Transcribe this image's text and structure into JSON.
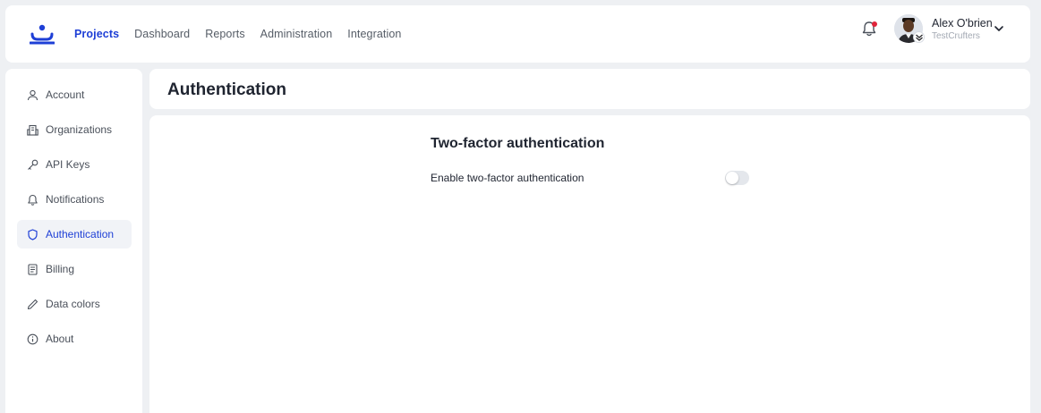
{
  "colors": {
    "accent": "#1e3fd6",
    "notification_dot": "#e0243b",
    "background": "#eef0f3"
  },
  "nav": {
    "logo_icon": "app-logo-icon",
    "items": [
      {
        "label": "Projects",
        "active": true
      },
      {
        "label": "Dashboard",
        "active": false
      },
      {
        "label": "Reports",
        "active": false
      },
      {
        "label": "Administration",
        "active": false
      },
      {
        "label": "Integration",
        "active": false
      }
    ]
  },
  "user": {
    "name": "Alex O'brien",
    "organization": "TestCrufters"
  },
  "sidebar": {
    "items": [
      {
        "label": "Account",
        "icon": "user-icon",
        "active": false
      },
      {
        "label": "Organizations",
        "icon": "building-icon",
        "active": false
      },
      {
        "label": "API Keys",
        "icon": "key-icon",
        "active": false
      },
      {
        "label": "Notifications",
        "icon": "bell-icon",
        "active": false
      },
      {
        "label": "Authentication",
        "icon": "shield-icon",
        "active": true
      },
      {
        "label": "Billing",
        "icon": "receipt-icon",
        "active": false
      },
      {
        "label": "Data colors",
        "icon": "pen-icon",
        "active": false
      },
      {
        "label": "About",
        "icon": "info-icon",
        "active": false
      }
    ]
  },
  "page": {
    "title": "Authentication",
    "section_title": "Two-factor authentication",
    "setting_label": "Enable two-factor authentication",
    "toggle_enabled": false
  }
}
